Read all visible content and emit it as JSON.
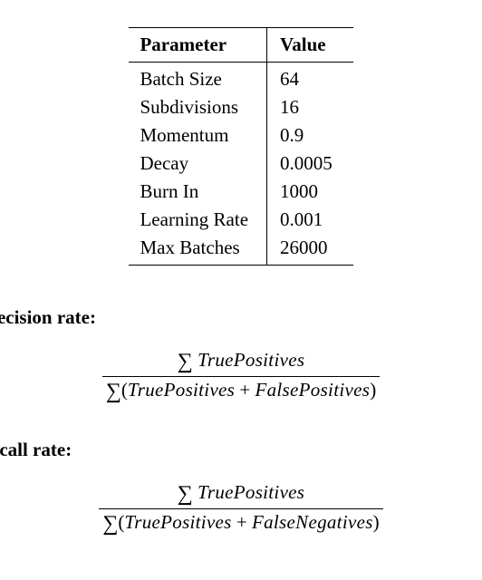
{
  "table": {
    "headers": [
      "Parameter",
      "Value"
    ],
    "rows": [
      {
        "param": "Batch Size",
        "value": "64"
      },
      {
        "param": "Subdivisions",
        "value": "16"
      },
      {
        "param": "Momentum",
        "value": "0.9"
      },
      {
        "param": "Decay",
        "value": "0.0005"
      },
      {
        "param": "Burn In",
        "value": "1000"
      },
      {
        "param": "Learning Rate",
        "value": "0.001"
      },
      {
        "param": "Max Batches",
        "value": "26000"
      }
    ]
  },
  "sections": {
    "precision": {
      "heading": "recision rate:",
      "formula": {
        "numerator_sum": "∑",
        "numerator_term": "TruePositives",
        "denominator_sum": "∑",
        "denominator_term1": "TruePositives",
        "denominator_plus": " + ",
        "denominator_term2": "FalsePositives"
      }
    },
    "recall": {
      "heading": "ecall rate:",
      "formula": {
        "numerator_sum": "∑",
        "numerator_term": "TruePositives",
        "denominator_sum": "∑",
        "denominator_term1": "TruePositives",
        "denominator_plus": " + ",
        "denominator_term2": "FalseNegatives"
      }
    }
  }
}
